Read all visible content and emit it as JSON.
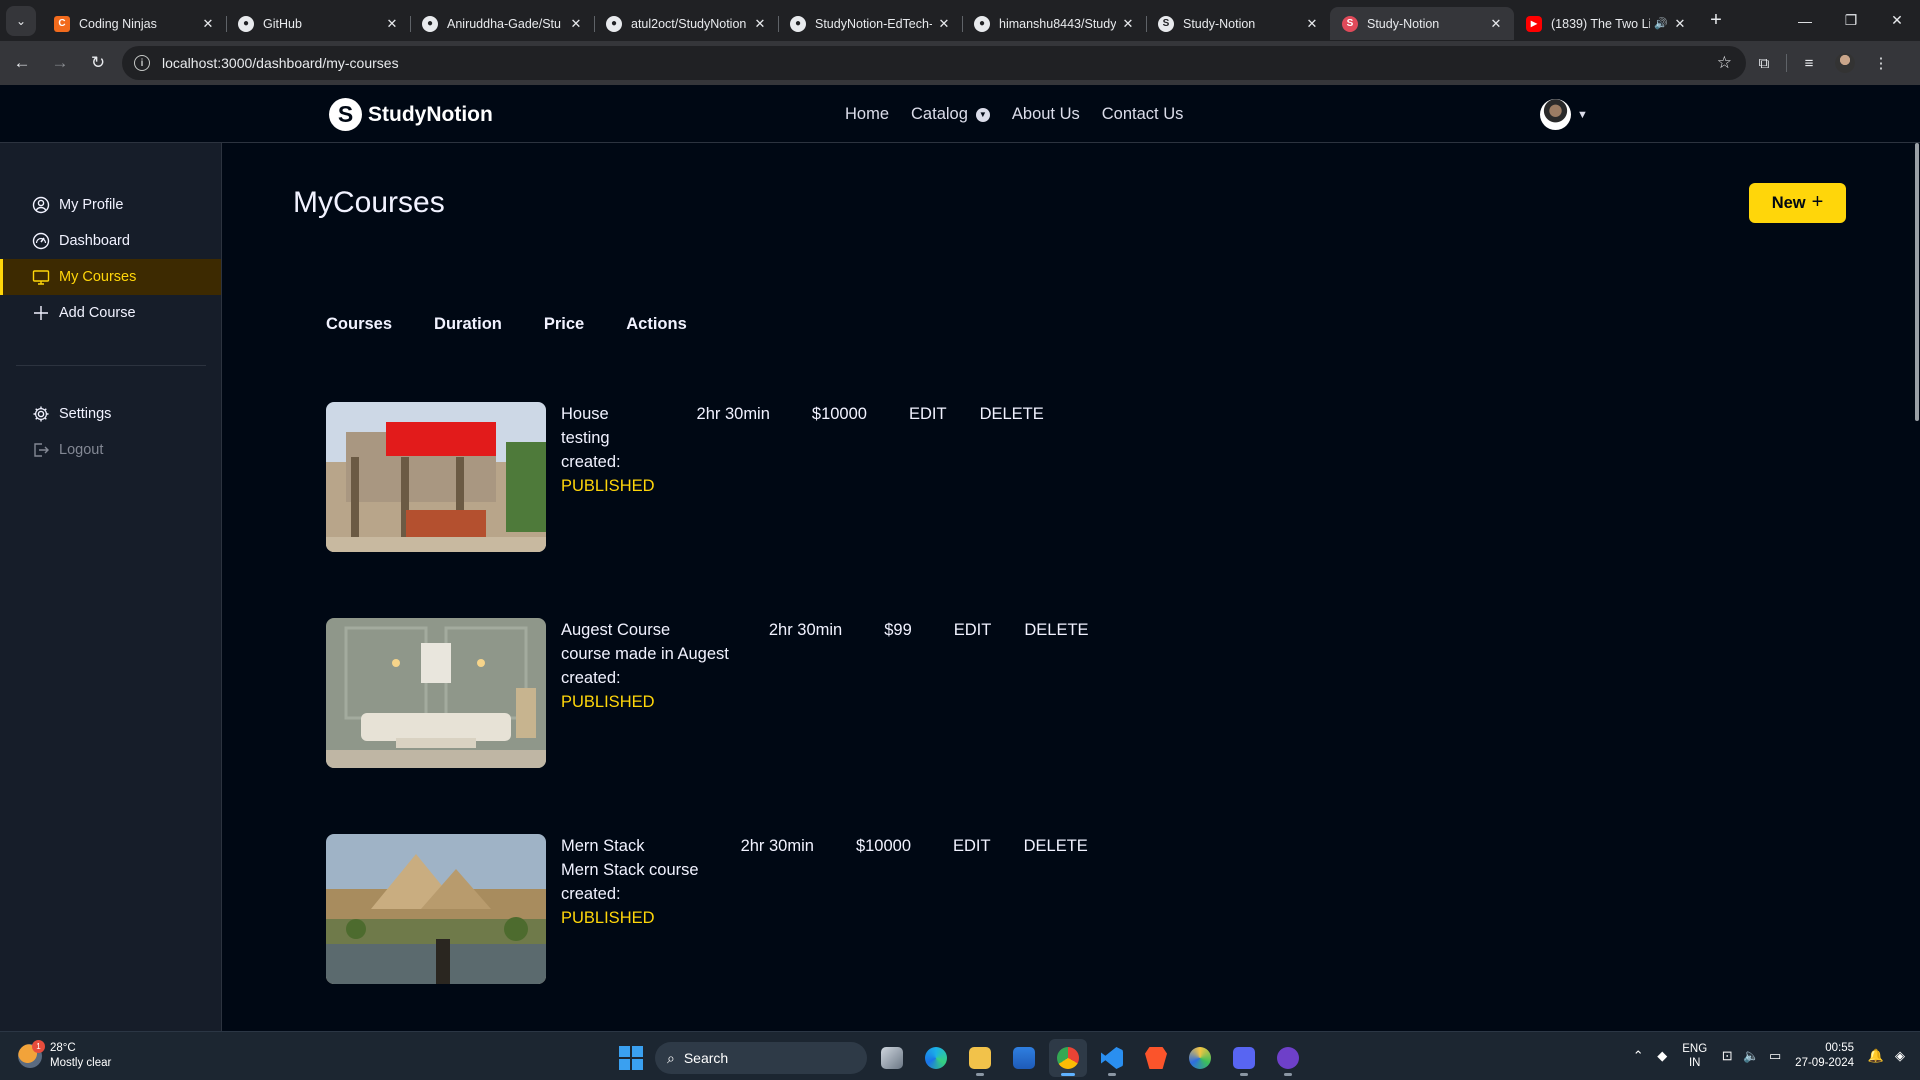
{
  "browser": {
    "tabs": [
      {
        "title": "Coding Ninjas",
        "favicon": "coding-ninjas-icon",
        "active": false
      },
      {
        "title": "GitHub",
        "favicon": "github-icon",
        "active": false
      },
      {
        "title": "Aniruddha-Gade/Stu",
        "favicon": "github-icon",
        "active": false
      },
      {
        "title": "atul2oct/StudyNotion",
        "favicon": "github-icon",
        "active": false
      },
      {
        "title": "StudyNotion-EdTech-",
        "favicon": "github-icon",
        "active": false
      },
      {
        "title": "himanshu8443/Study",
        "favicon": "github-icon",
        "active": false
      },
      {
        "title": "Study-Notion",
        "favicon": "studynotion-icon",
        "active": false
      },
      {
        "title": "Study-Notion",
        "favicon": "studynotion-red-icon",
        "active": true
      },
      {
        "title": "(1839) The Two Li",
        "favicon": "youtube-icon",
        "active": false
      }
    ],
    "url": "localhost:3000/dashboard/my-courses"
  },
  "nav": {
    "logo_letter": "S",
    "logo_text": "StudyNotion",
    "links": [
      "Home",
      "Catalog",
      "About Us",
      "Contact Us"
    ]
  },
  "sidebar": {
    "items": [
      {
        "label": "My Profile",
        "icon": "user-circle-icon"
      },
      {
        "label": "Dashboard",
        "icon": "gauge-icon"
      },
      {
        "label": "My Courses",
        "icon": "monitor-icon"
      },
      {
        "label": "Add Course",
        "icon": "plus-icon"
      }
    ],
    "bottom": [
      {
        "label": "Settings",
        "icon": "gear-icon"
      },
      {
        "label": "Logout",
        "icon": "logout-icon"
      }
    ]
  },
  "main": {
    "title": "MyCourses",
    "new_button": "New",
    "headers": [
      "Courses",
      "Duration",
      "Price",
      "Actions"
    ],
    "courses": [
      {
        "name": "House testing",
        "name_lines": [
          "House",
          "testing"
        ],
        "created": "created:",
        "status": "PUBLISHED",
        "duration": "2hr 30min",
        "price": "$10000",
        "edit": "EDIT",
        "delete": "DELETE"
      },
      {
        "name": "Augest Course course made in Augest",
        "name_lines": [
          "Augest Course",
          "course made in Augest"
        ],
        "created": "created:",
        "status": "PUBLISHED",
        "duration": "2hr 30min",
        "price": "$99",
        "edit": "EDIT",
        "delete": "DELETE"
      },
      {
        "name": "Mern Stack Mern Stack course",
        "name_lines": [
          "Mern Stack",
          "Mern Stack course"
        ],
        "created": "created:",
        "status": "PUBLISHED",
        "duration": "2hr 30min",
        "price": "$10000",
        "edit": "EDIT",
        "delete": "DELETE"
      }
    ]
  },
  "taskbar": {
    "weather_temp": "28°C",
    "weather_desc": "Mostly clear",
    "weather_badge": "1",
    "search": "Search",
    "lang_1": "ENG",
    "lang_2": "IN",
    "time": "00:55",
    "date": "27-09-2024"
  },
  "colors": {
    "accent": "#FFD60A",
    "background": "#000814",
    "sidebar": "#161D29",
    "active_bg": "#3D2A01"
  }
}
